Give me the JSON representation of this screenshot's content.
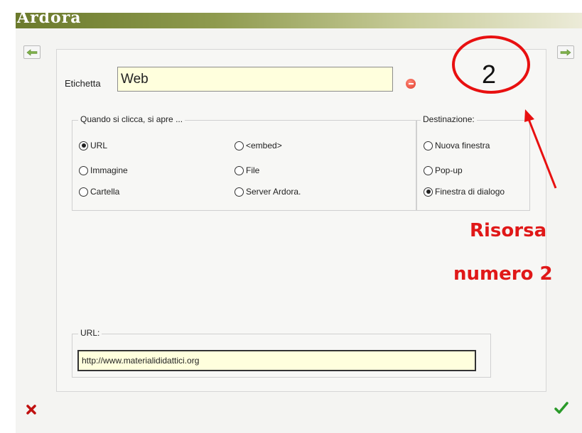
{
  "window": {
    "title": "Ardora"
  },
  "nav": {
    "prev_icon": "arrow-left-icon",
    "next_icon": "arrow-right-icon"
  },
  "form": {
    "etichetta_label": "Etichetta",
    "etichetta_value": "Web",
    "remove_icon": "minus-circle-icon",
    "open_group": {
      "legend": "Quando si clicca, si apre ...",
      "options": [
        {
          "label": "URL",
          "checked": true
        },
        {
          "label": "<embed>",
          "checked": false
        },
        {
          "label": "Immagine",
          "checked": false
        },
        {
          "label": "File",
          "checked": false
        },
        {
          "label": "Cartella",
          "checked": false
        },
        {
          "label": "Server Ardora.",
          "checked": false
        }
      ]
    },
    "destination_group": {
      "legend": "Destinazione:",
      "options": [
        {
          "label": "Nuova finestra",
          "checked": false
        },
        {
          "label": "Pop-up",
          "checked": false
        },
        {
          "label": "Finestra di dialogo",
          "checked": true
        }
      ]
    },
    "url_group": {
      "legend": "URL:",
      "value": "http://www.materialididattici.org"
    }
  },
  "footer": {
    "cancel_icon": "red-x-icon",
    "confirm_icon": "green-check-icon"
  },
  "annotation": {
    "number": "2",
    "line1": "Risorsa",
    "line2": "numero 2",
    "color": "#e01818"
  }
}
